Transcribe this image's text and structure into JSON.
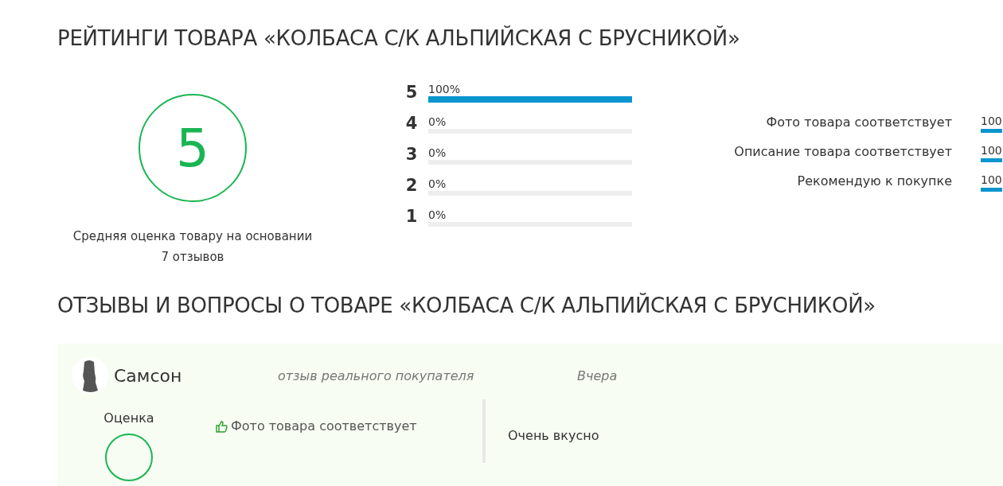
{
  "rating_title": "РЕЙТИНГИ ТОВАРА «КОЛБАСА С/К АЛЬПИЙСКАЯ С БРУСНИКОЙ»",
  "average": {
    "score": "5",
    "caption": "Средняя оценка товару на основании",
    "count": "7 отзывов"
  },
  "distribution": [
    {
      "stars": "5",
      "percent": "100%",
      "level": 1
    },
    {
      "stars": "4",
      "percent": "0%",
      "level": 0
    },
    {
      "stars": "3",
      "percent": "0%",
      "level": 0
    },
    {
      "stars": "2",
      "percent": "0%",
      "level": 0
    },
    {
      "stars": "1",
      "percent": "0%",
      "level": 0
    }
  ],
  "criteria": [
    {
      "label": "Фото товара соответствует",
      "value": "100",
      "level": 1
    },
    {
      "label": "Описание товара соответствует",
      "value": "100",
      "level": 1
    },
    {
      "label": "Рекомендую к покупке",
      "value": "100",
      "level": 1
    }
  ],
  "reviews_title": "ОТЗЫВЫ И ВОПРОСЫ О ТОВАРЕ «КОЛБАСА С/К АЛЬПИЙСКАЯ С БРУСНИКОЙ»",
  "reviews": [
    {
      "author": "Самсон",
      "badge": "отзыв реального покупателя",
      "date": "Вчера",
      "rating_label": "Оценка",
      "pros": [
        "Фото товара соответствует"
      ],
      "text": "Очень вкусно"
    }
  ]
}
